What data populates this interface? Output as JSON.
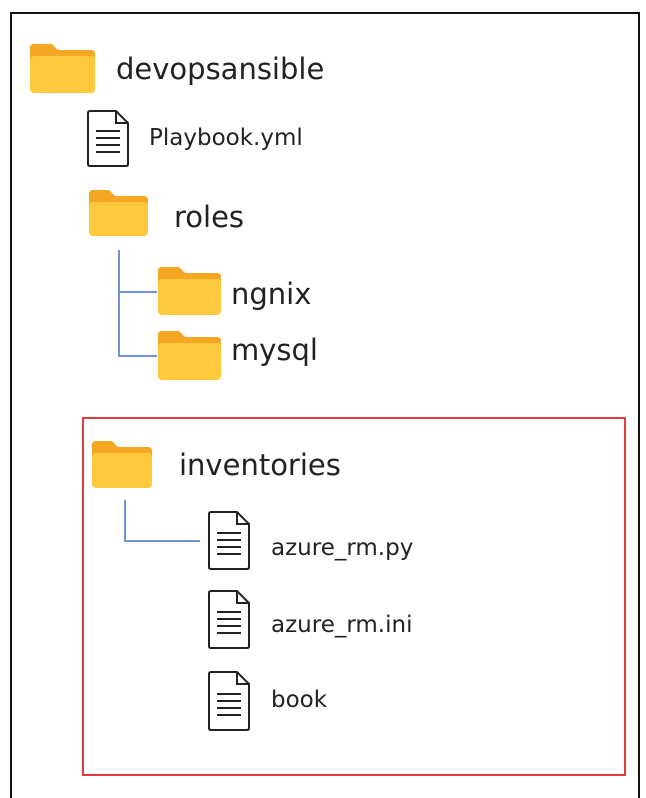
{
  "tree": {
    "root": {
      "label": "devopsansible",
      "icon": "folder-icon"
    },
    "playbook": {
      "label": "Playbook.yml",
      "icon": "file-icon"
    },
    "roles": {
      "label": "roles",
      "icon": "folder-icon",
      "children": [
        {
          "label": "ngnix",
          "icon": "folder-icon"
        },
        {
          "label": "mysql",
          "icon": "folder-icon"
        }
      ]
    },
    "inventories": {
      "label": "inventories",
      "icon": "folder-icon",
      "children": [
        {
          "label": "azure_rm.py",
          "icon": "file-icon"
        },
        {
          "label": "azure_rm.ini",
          "icon": "file-icon"
        },
        {
          "label": "book",
          "icon": "file-icon"
        }
      ]
    }
  },
  "colors": {
    "folder_front": "#ffc83d",
    "folder_back": "#f5a623",
    "connector": "#6f93d8",
    "highlight_border": "#e23c3c",
    "frame_border": "#111111",
    "text": "#222222"
  }
}
